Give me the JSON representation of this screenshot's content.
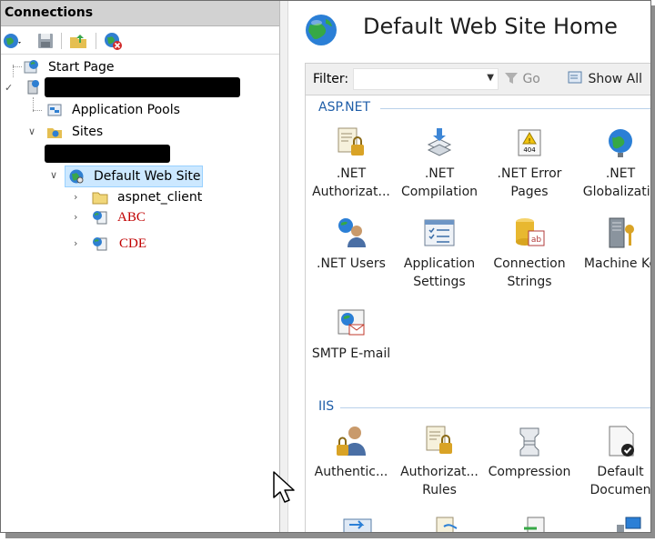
{
  "connections": {
    "title": "Connections",
    "tree": {
      "start_page": "Start Page",
      "application_pools": "Application Pools",
      "sites": "Sites",
      "default_web_site": "Default Web Site",
      "aspnet_client": "aspnet_client",
      "site_abc": "ABC",
      "site_cde": "CDE"
    }
  },
  "main": {
    "title": "Default Web Site Home",
    "filter_label": "Filter:",
    "filter_value": "",
    "go_label": "Go",
    "show_all_label": "Show All",
    "groups": {
      "aspnet": {
        "title": "ASP.NET",
        "items": [
          {
            "line1": ".NET",
            "line2": "Authorizat..."
          },
          {
            "line1": ".NET",
            "line2": "Compilation"
          },
          {
            "line1": ".NET Error",
            "line2": "Pages"
          },
          {
            "line1": ".NET",
            "line2": "Globalizatio"
          },
          {
            "line1": ".NET Users",
            "line2": ""
          },
          {
            "line1": "Application",
            "line2": "Settings"
          },
          {
            "line1": "Connection",
            "line2": "Strings"
          },
          {
            "line1": "Machine Ke",
            "line2": ""
          },
          {
            "line1": "SMTP E-mail",
            "line2": ""
          }
        ]
      },
      "iis": {
        "title": "IIS",
        "items": [
          {
            "line1": "Authentic...",
            "line2": ""
          },
          {
            "line1": "Authorizat...",
            "line2": "Rules"
          },
          {
            "line1": "Compression",
            "line2": ""
          },
          {
            "line1": "Default",
            "line2": "Documen"
          }
        ]
      }
    }
  }
}
